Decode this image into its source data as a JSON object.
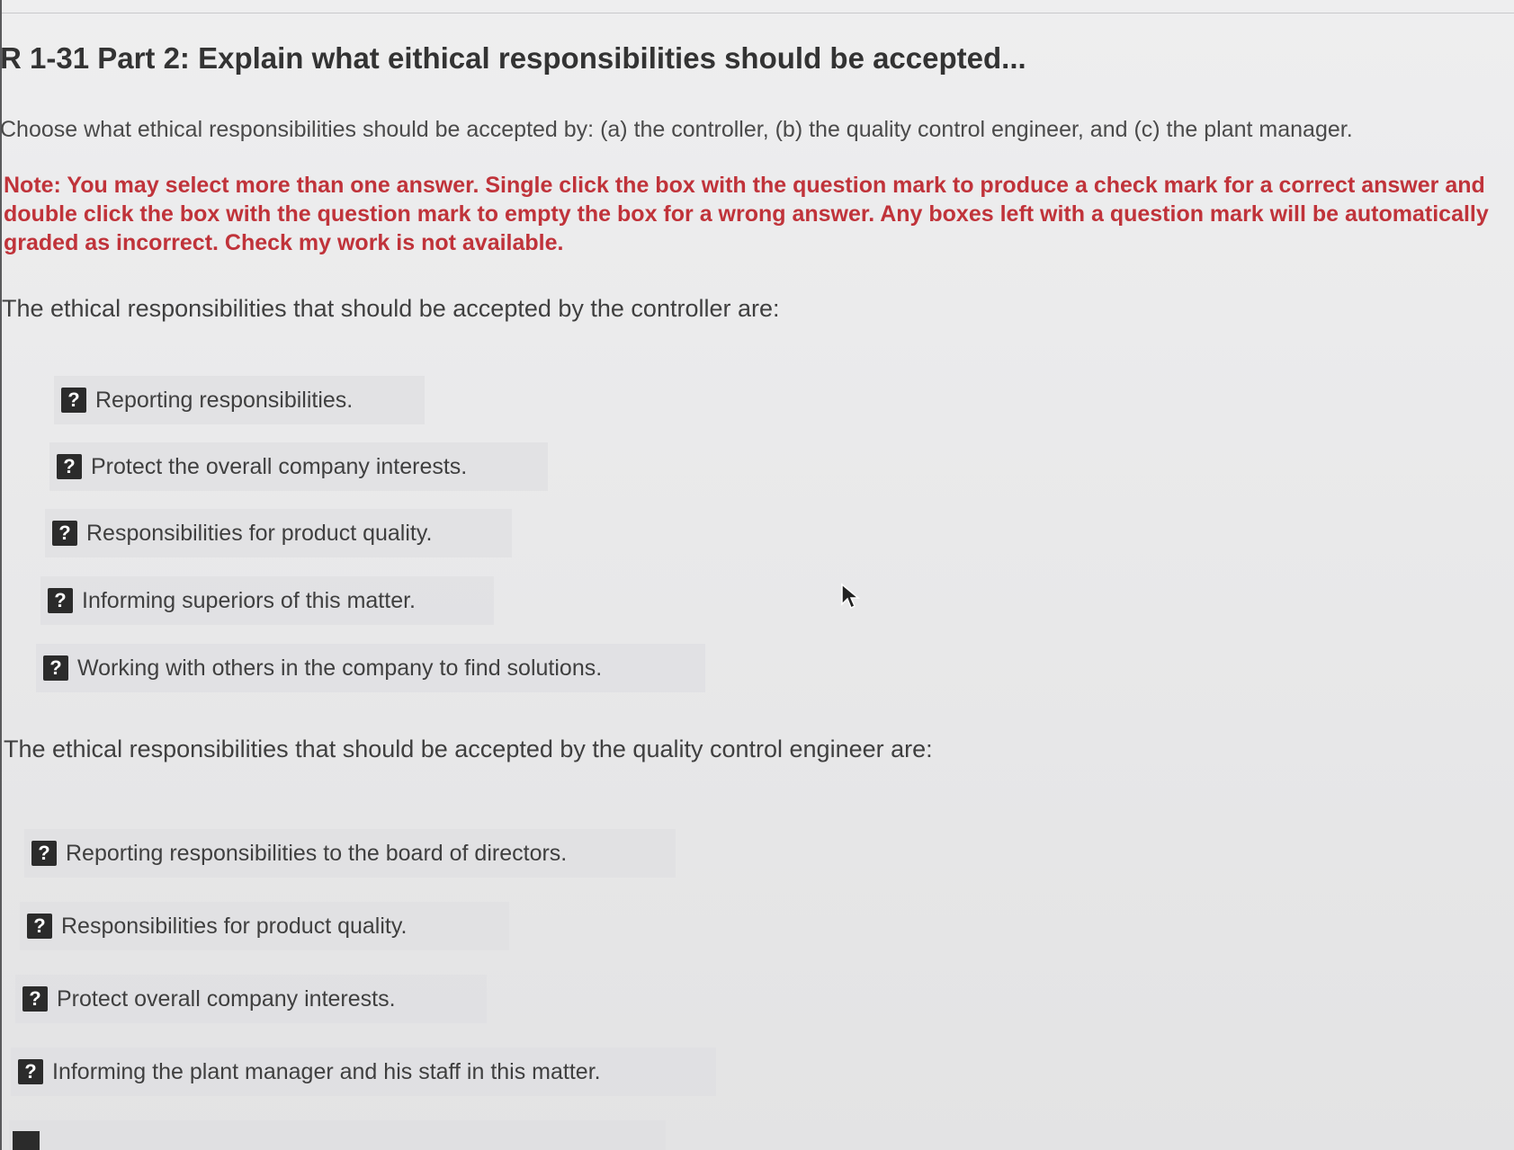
{
  "title": "R 1-31 Part 2: Explain what eithical responsibilities should be accepted...",
  "instructions": "Choose what ethical responsibilities should be accepted by: (a) the controller, (b) the quality control engineer, and (c) the plant manager.",
  "note": "Note: You may select more than one answer. Single click the box with the question mark to produce a check mark for a correct answer and double click the box with the question mark to empty the box for a wrong answer. Any boxes left with a question mark will be automatically graded as incorrect. Check my work is not available.",
  "icons": {
    "status_box": "question-mark-box-icon",
    "pointer": "mouse-cursor-icon"
  },
  "colors": {
    "note_red": "#c0333a",
    "box_dark": "#2b2b2b"
  },
  "sections": [
    {
      "heading": "The ethical responsibilities that should be accepted by the controller are:",
      "options": [
        {
          "box": "?",
          "label": "Reporting responsibilities."
        },
        {
          "box": "?",
          "label": "Protect the overall company interests."
        },
        {
          "box": "?",
          "label": "Responsibilities for product quality."
        },
        {
          "box": "?",
          "label": "Informing superiors of this matter."
        },
        {
          "box": "?",
          "label": "Working with others in the company to find solutions."
        }
      ]
    },
    {
      "heading": "The ethical responsibilities that should be accepted by the quality control engineer are:",
      "options": [
        {
          "box": "?",
          "label": "Reporting responsibilities to the board of directors."
        },
        {
          "box": "?",
          "label": "Responsibilities for product quality."
        },
        {
          "box": "?",
          "label": "Protect overall company interests."
        },
        {
          "box": "?",
          "label": "Informing the plant manager and his staff in this matter."
        }
      ]
    }
  ]
}
